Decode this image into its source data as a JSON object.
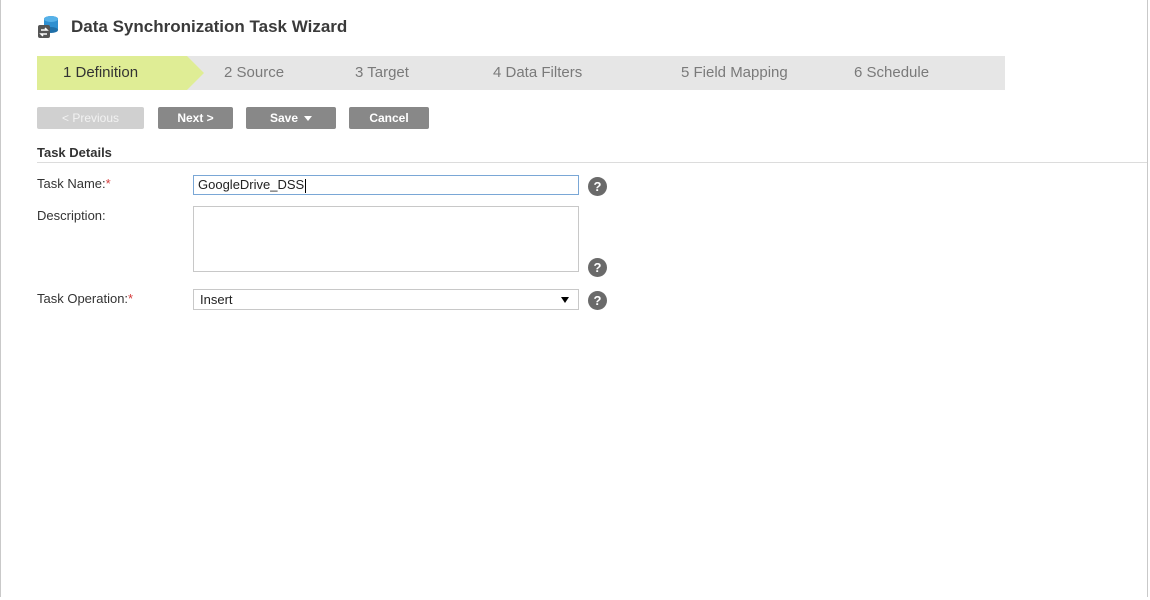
{
  "header": {
    "title": "Data Synchronization Task Wizard",
    "icon": "database-sync-icon"
  },
  "steps": [
    {
      "label": "1 Definition",
      "active": true
    },
    {
      "label": "2 Source",
      "active": false
    },
    {
      "label": "3 Target",
      "active": false
    },
    {
      "label": "4 Data Filters",
      "active": false
    },
    {
      "label": "5 Field Mapping",
      "active": false
    },
    {
      "label": "6 Schedule",
      "active": false
    }
  ],
  "toolbar": {
    "previous_label": "< Previous",
    "next_label": "Next >",
    "save_label": "Save",
    "cancel_label": "Cancel"
  },
  "section": {
    "title": "Task Details"
  },
  "fields": {
    "task_name": {
      "label": "Task Name:",
      "required_mark": "*",
      "value": "GoogleDrive_DSS"
    },
    "description": {
      "label": "Description:",
      "value": ""
    },
    "task_operation": {
      "label": "Task Operation:",
      "required_mark": "*",
      "value": "Insert"
    }
  },
  "help_icon": "?",
  "colors": {
    "active_step": "#dfed95",
    "step_bar": "#e6e6e6",
    "button": "#888888",
    "required": "#d43b3b"
  }
}
